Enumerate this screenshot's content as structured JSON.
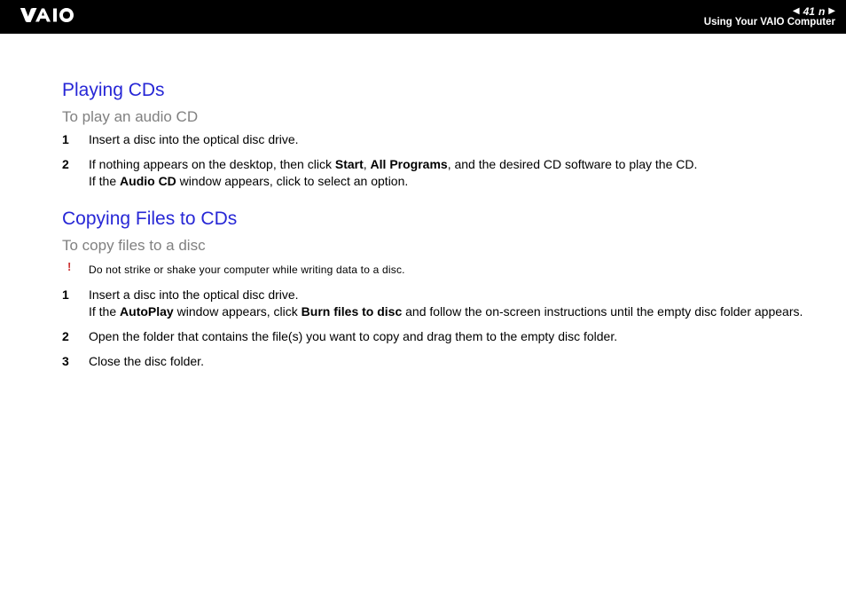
{
  "header": {
    "page_number": "41",
    "n_label": "n",
    "subtitle": "Using Your VAIO Computer"
  },
  "playing": {
    "title": "Playing CDs",
    "subtitle": "To play an audio CD",
    "step1": "Insert a disc into the optical disc drive.",
    "step2_prefix": "If nothing appears on the desktop, then click ",
    "step2_b1": "Start",
    "step2_m1": ", ",
    "step2_b2": "All Programs",
    "step2_suffix": ", and the desired CD software to play the CD.",
    "step2_line2_prefix": "If the ",
    "step2_line2_b": "Audio CD",
    "step2_line2_suffix": " window appears, click to select an option."
  },
  "copying": {
    "title": "Copying Files to CDs",
    "subtitle": "To copy files to a disc",
    "warning_mark": "!",
    "warning_text": "Do not strike or shake your computer while writing data to a disc.",
    "step1_line1": "Insert a disc into the optical disc drive.",
    "step1_line2_prefix": "If the ",
    "step1_line2_b1": "AutoPlay",
    "step1_line2_m1": " window appears, click ",
    "step1_line2_b2": "Burn files to disc",
    "step1_line2_suffix": " and follow the on-screen instructions until the empty disc folder appears.",
    "step2": "Open the folder that contains the file(s) you want to copy and drag them to the empty disc folder.",
    "step3": "Close the disc folder."
  }
}
